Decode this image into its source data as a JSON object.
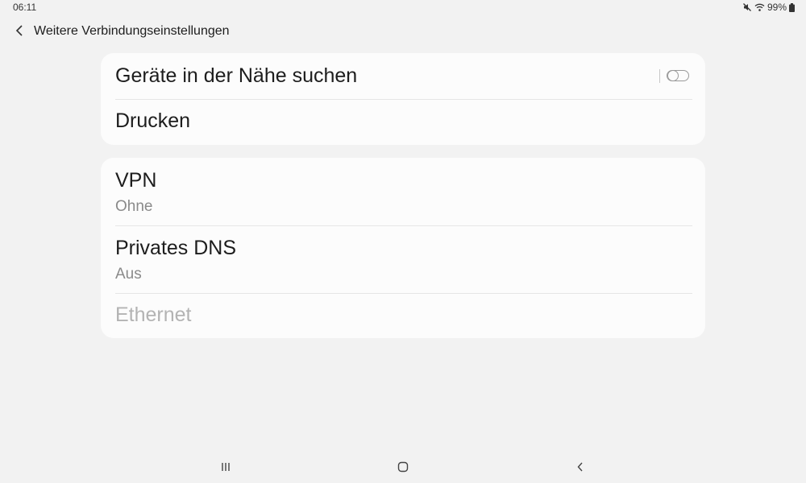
{
  "status_bar": {
    "time": "06:11",
    "battery": "99%",
    "icons": [
      "mute-icon",
      "wifi-icon",
      "battery-icon"
    ]
  },
  "app_bar": {
    "title": "Weitere Verbindungseinstellungen",
    "back_icon": "chevron-left-icon"
  },
  "card1": {
    "items": [
      {
        "title": "Geräte in der Nähe suchen",
        "toggle": false
      },
      {
        "title": "Drucken"
      }
    ]
  },
  "card2": {
    "items": [
      {
        "title": "VPN",
        "subtitle": "Ohne"
      },
      {
        "title": "Privates DNS",
        "subtitle": "Aus"
      },
      {
        "title": "Ethernet",
        "disabled": true
      }
    ]
  },
  "nav_bar": {
    "icons": [
      "recents-icon",
      "home-icon",
      "back-icon"
    ]
  },
  "colors": {
    "background": "#f2f2f2",
    "card": "#fcfcfc",
    "text_primary": "#1d1d1d",
    "text_secondary": "#8a8a8a",
    "text_disabled": "#b3b3b3"
  }
}
